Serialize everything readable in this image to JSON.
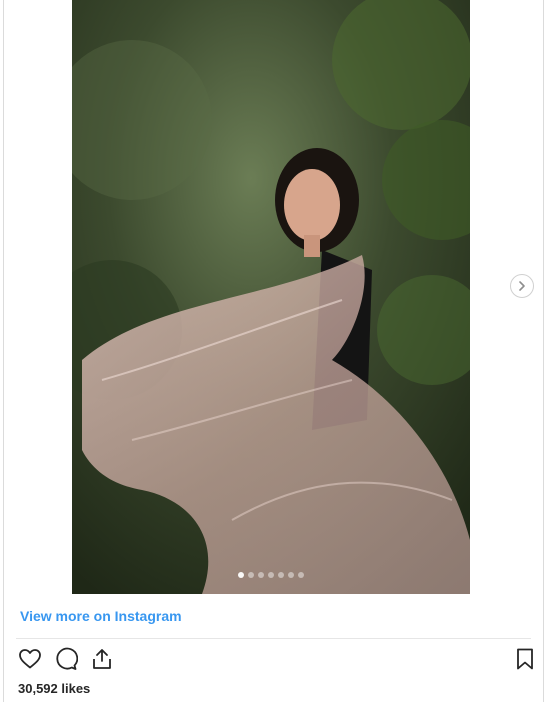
{
  "post": {
    "image_alt": "Woman in black top with sheer pink dupatta in a garden",
    "carousel": {
      "slide_count": 7,
      "active_index": 0
    },
    "view_more_label": "View more on Instagram",
    "likes": "30,592 likes"
  },
  "icons": {
    "like": "heart-icon",
    "comment": "comment-icon",
    "share": "share-icon",
    "save": "bookmark-icon",
    "next": "chevron-right-icon"
  },
  "colors": {
    "link": "#3897f0",
    "text": "#262626",
    "divider": "#e6e6e6"
  }
}
